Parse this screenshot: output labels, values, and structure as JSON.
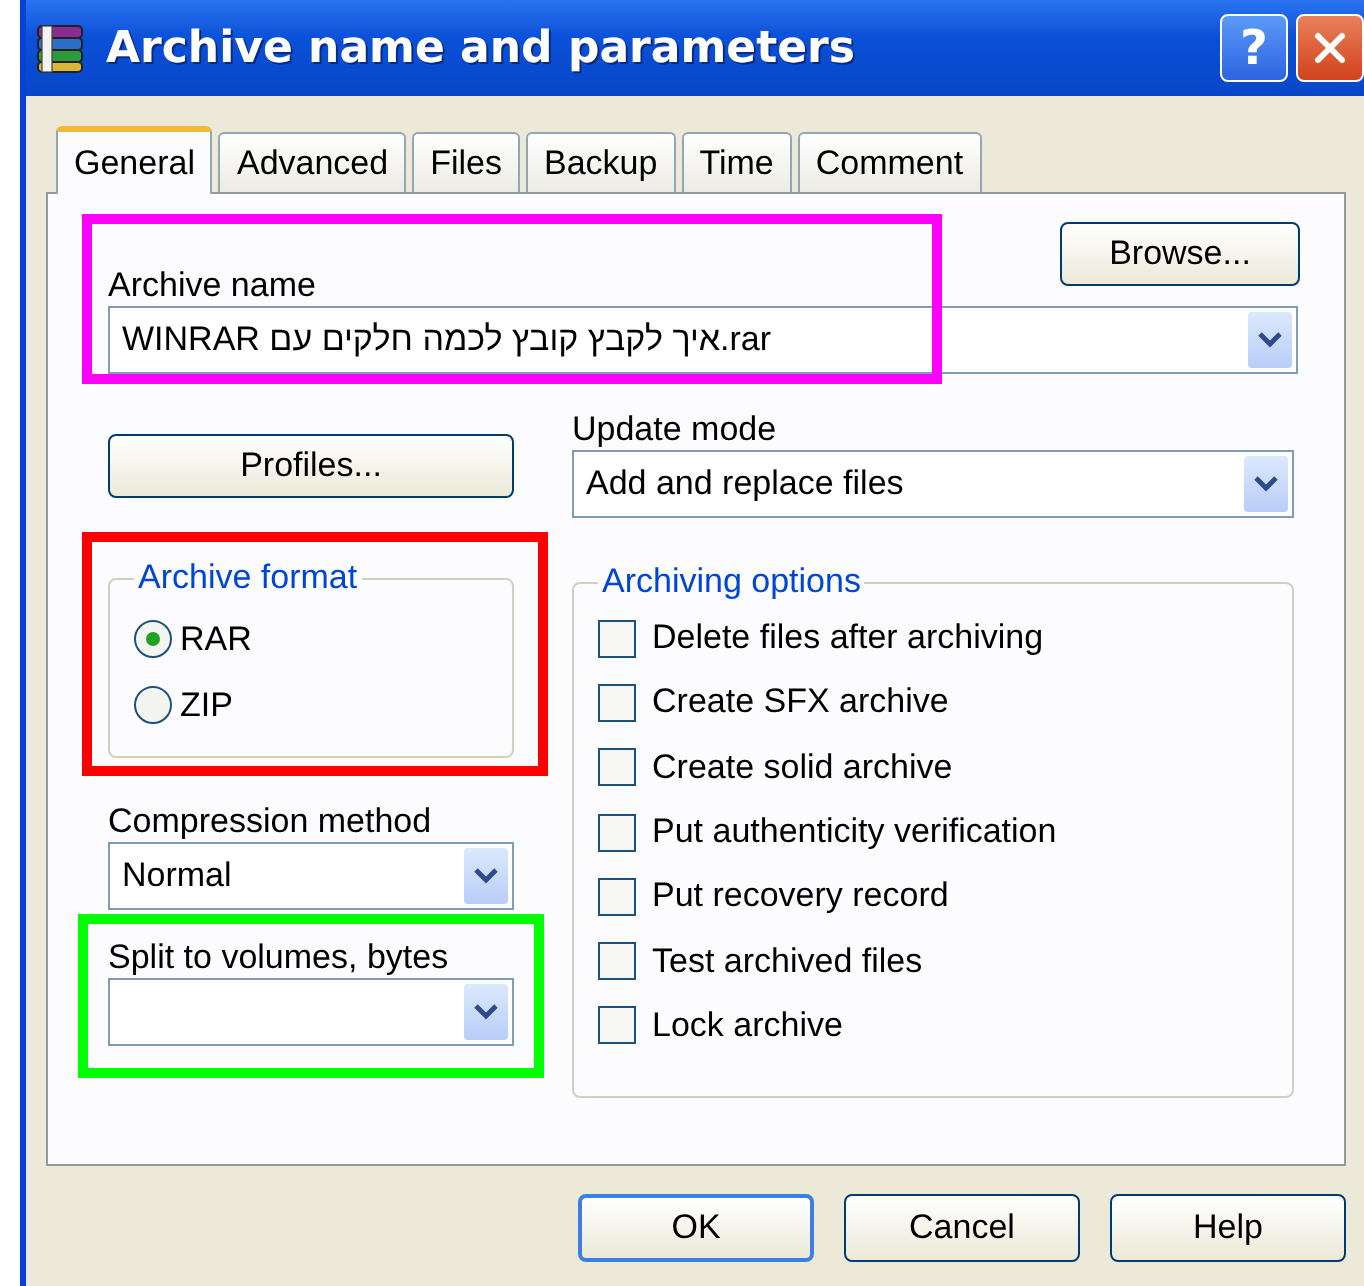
{
  "window": {
    "title": "Archive name and parameters",
    "help_button": "?"
  },
  "tabs": [
    {
      "label": "General",
      "selected": true
    },
    {
      "label": "Advanced",
      "selected": false
    },
    {
      "label": "Files",
      "selected": false
    },
    {
      "label": "Backup",
      "selected": false
    },
    {
      "label": "Time",
      "selected": false
    },
    {
      "label": "Comment",
      "selected": false
    }
  ],
  "archive_name": {
    "label": "Archive name",
    "value": "WINRAR איך לקבץ קובץ לכמה חלקים עם.rar",
    "color": "#ff00ff"
  },
  "browse_button": "Browse...",
  "profiles_button": "Profiles...",
  "update_mode": {
    "label": "Update mode",
    "value": "Add and replace files"
  },
  "archive_format": {
    "title": "Archive format",
    "color": "#ff0000",
    "options": [
      {
        "label": "RAR",
        "selected": true
      },
      {
        "label": "ZIP",
        "selected": false
      }
    ]
  },
  "compression_method": {
    "label": "Compression method",
    "value": "Normal"
  },
  "split_volumes": {
    "label": "Split to volumes, bytes",
    "color": "#00ff00"
  },
  "archiving_options": {
    "title": "Archiving options",
    "items": [
      {
        "label": "Delete files after archiving",
        "checked": false
      },
      {
        "label": "Create SFX archive",
        "checked": false
      },
      {
        "label": "Create solid archive",
        "checked": false
      },
      {
        "label": "Put authenticity verification",
        "checked": false
      },
      {
        "label": "Put recovery record",
        "checked": false
      },
      {
        "label": "Test archived files",
        "checked": false
      },
      {
        "label": "Lock archive",
        "checked": false
      }
    ]
  },
  "buttons": [
    {
      "label": "OK",
      "default": true
    },
    {
      "label": "Cancel",
      "default": false
    },
    {
      "label": "Help",
      "default": false
    }
  ]
}
